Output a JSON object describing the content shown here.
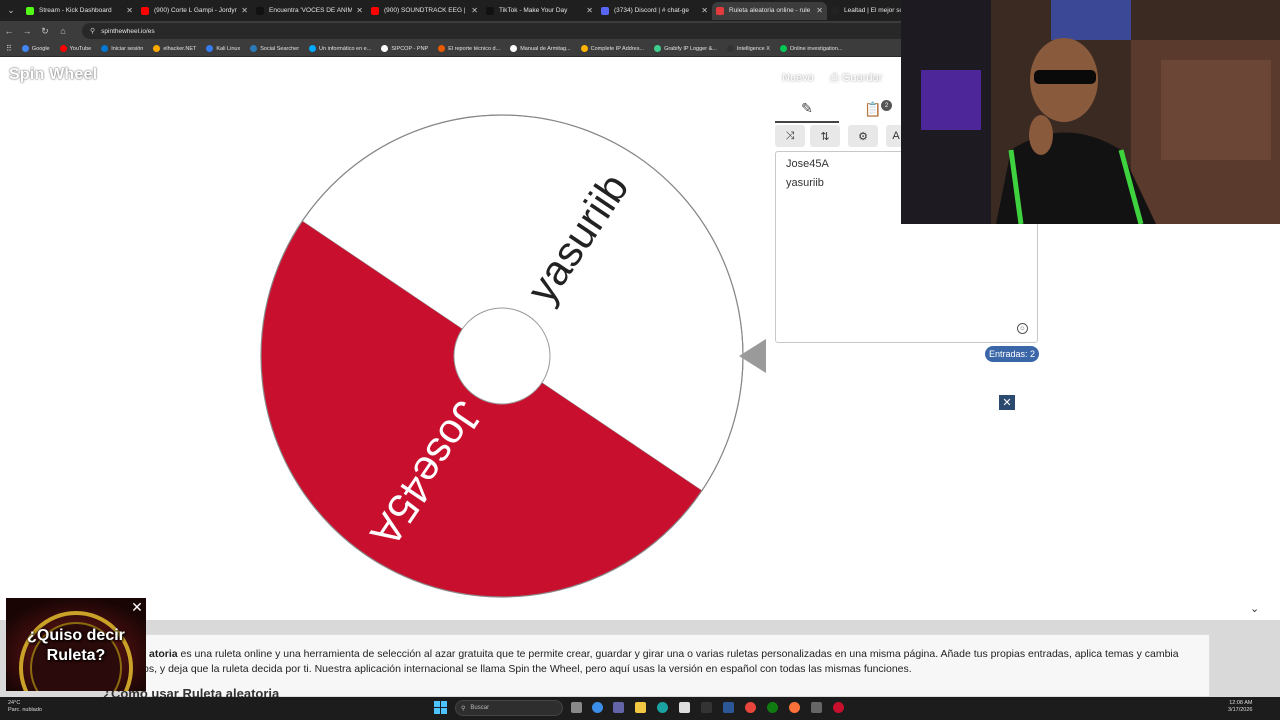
{
  "browser": {
    "tabs": [
      {
        "title": "Stream - Kick Dashboard",
        "color": "#53fc18",
        "active": false
      },
      {
        "title": "(900) Corte L Gampi - Jordyn",
        "color": "#ff0000",
        "active": false
      },
      {
        "title": "Encuentra 'VOCES DE ANIMA",
        "color": "#111111",
        "active": false
      },
      {
        "title": "(900) SOUNDTRACK EEG | CC",
        "color": "#ff0000",
        "active": false
      },
      {
        "title": "TikTok - Make Your Day",
        "color": "#111111",
        "active": false
      },
      {
        "title": "(3734) Discord | # chat-ge",
        "color": "#5865f2",
        "active": false
      },
      {
        "title": "Ruleta aleatoria online - rule",
        "color": "#e33b3b",
        "active": true
      },
      {
        "title": "Lealtad | El mejor softw",
        "color": "#222222",
        "active": false
      }
    ],
    "url": "spinthewheel.io/es",
    "bookmarks": [
      {
        "label": "Google",
        "color": "#4285f4"
      },
      {
        "label": "YouTube",
        "color": "#ff0000"
      },
      {
        "label": "Iniciar sesión",
        "color": "#0078d4"
      },
      {
        "label": "elhacker.NET",
        "color": "#ffaa00"
      },
      {
        "label": "Kali Linux",
        "color": "#367bf0"
      },
      {
        "label": "Social Searcher",
        "color": "#2b7bb9"
      },
      {
        "label": "Un informático en e...",
        "color": "#00aaff"
      },
      {
        "label": "SIPCOP - PNP",
        "color": "#ffffff"
      },
      {
        "label": "El reporte técnico d...",
        "color": "#e85a00"
      },
      {
        "label": "Manual de Armitag...",
        "color": "#ffffff"
      },
      {
        "label": "Complete IP Addres...",
        "color": "#ffb400"
      },
      {
        "label": "Grabify IP Logger &...",
        "color": "#3ecf8e"
      },
      {
        "label": "Intelligence X",
        "color": "#333333"
      },
      {
        "label": "Online investigation...",
        "color": "#00c853"
      }
    ]
  },
  "app": {
    "logo": "Spin Wheel",
    "new_label": "Nuevo",
    "save_label": "Guardar",
    "wheel": {
      "segments": [
        {
          "label": "yasuriib",
          "color": "#ffffff",
          "text_color": "#222222"
        },
        {
          "label": "Jose45A",
          "color": "#c8102e",
          "text_color": "#ffffff"
        }
      ],
      "pointer_color": "#9a9a9a"
    },
    "panel": {
      "tab_badge": "2",
      "entries": [
        "Jose45A",
        "yasuriib"
      ],
      "tool_extra": "A",
      "entries_count": "Entradas: 2"
    },
    "popup": {
      "line1": "¿Quiso decir",
      "line2": "Ruleta?",
      "close": "✕"
    },
    "description": {
      "bold": "atoria",
      "text1": " es una ruleta online y una herramienta de selección al azar gratuita que te permite crear, guardar y girar una o varias ruletas personalizadas en una misma página. Añade tus propias entradas, aplica temas y cambia",
      "text2": "os, y deja que la ruleta decida por ti. Nuestra aplicación internacional se llama Spin the Wheel, pero aquí usas la versión en español con todas las mismas funciones.",
      "heading": "¿Cómo usar Ruleta aleatoria"
    }
  },
  "taskbar": {
    "weather_temp": "24°C",
    "weather_desc": "Parc. nublado",
    "search_placeholder": "Buscar",
    "time": "12:08 AM",
    "date": "3/17/2026"
  }
}
